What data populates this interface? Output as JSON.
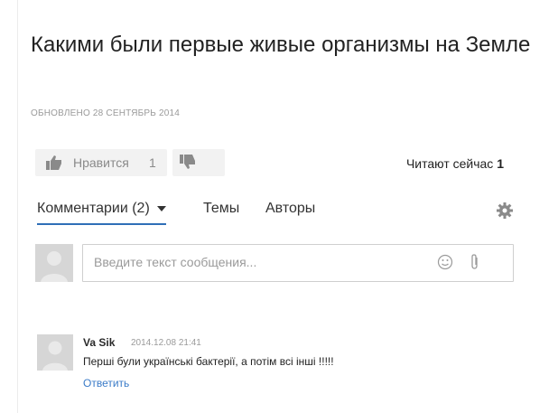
{
  "article": {
    "title": "Какими были первые живые организмы на Земле",
    "updated": "ОБНОВЛЕНО 28 СЕНТЯБРЬ 2014"
  },
  "reactions": {
    "like_label": "Нравится",
    "like_count": "1",
    "reading_label": "Читают сейчас",
    "reading_count": "1"
  },
  "tabs": {
    "comments": "Комментарии (2)",
    "topics": "Темы",
    "authors": "Авторы"
  },
  "composer": {
    "placeholder": "Введите текст сообщения..."
  },
  "comments": [
    {
      "author": "Va Sik",
      "date": "2014.12.08 21:41",
      "text": "Перші були українські бактерії, а потім всі інші !!!!!",
      "reply_label": "Ответить"
    }
  ],
  "icons": {
    "like": "thumbs-up-icon",
    "dislike": "thumbs-down-icon",
    "settings": "gear-icon",
    "emoji": "smiley-icon",
    "attach": "paperclip-icon",
    "dropdown": "chevron-down-icon"
  },
  "colors": {
    "accent": "#2f6fb7",
    "link": "#3a7bc8",
    "muted": "#9a9a9a"
  }
}
